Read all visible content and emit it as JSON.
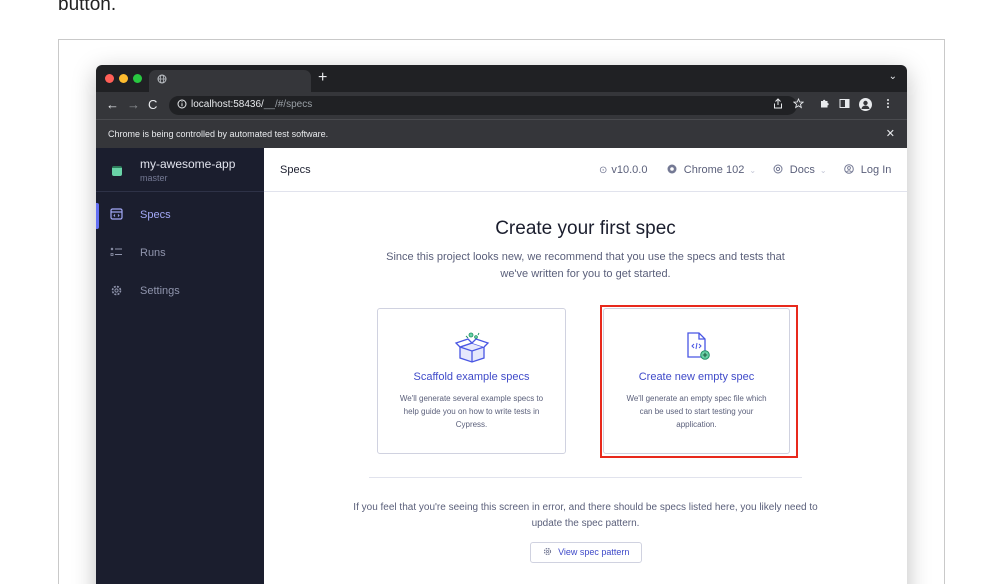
{
  "page_top_text": "button.",
  "browser": {
    "tab_icon": "globe-icon",
    "new_tab_symbol": "+",
    "tab_menu_symbol": "⌄",
    "nav": {
      "back": "←",
      "forward": "→",
      "reload": "C"
    },
    "url_host": "localhost:58436/",
    "url_path": "__/#/specs",
    "automation_notice": "Chrome is being controlled by automated test software.",
    "close_symbol": "✕"
  },
  "sidebar": {
    "project_name": "my-awesome-app",
    "branch": "master",
    "items": [
      {
        "label": "Specs",
        "icon": "specs-icon",
        "active": true
      },
      {
        "label": "Runs",
        "icon": "runs-icon",
        "active": false
      },
      {
        "label": "Settings",
        "icon": "gear-icon",
        "active": false
      }
    ]
  },
  "header": {
    "title": "Specs",
    "version": "v10.0.0",
    "browser_name": "Chrome 102",
    "docs": "Docs",
    "login": "Log In"
  },
  "main": {
    "headline": "Create your first spec",
    "description": "Since this project looks new, we recommend that you use the specs and tests that we've written for you to get started.",
    "cards": [
      {
        "title": "Scaffold example specs",
        "description": "We'll generate several example specs to help guide you on how to write tests in Cypress.",
        "icon": "box-icon"
      },
      {
        "title": "Create new empty spec",
        "description": "We'll generate an empty spec file which can be used to start testing your application.",
        "icon": "new-file-icon"
      }
    ],
    "error_text": "If you feel that you're seeing this screen in error, and there should be specs listed here, you likely need to update the spec pattern.",
    "spec_pattern_button": "View spec pattern"
  },
  "colors": {
    "accent": "#3f4ac9",
    "sidebar_bg": "#1b1e2e",
    "highlight": "#e8291c"
  }
}
